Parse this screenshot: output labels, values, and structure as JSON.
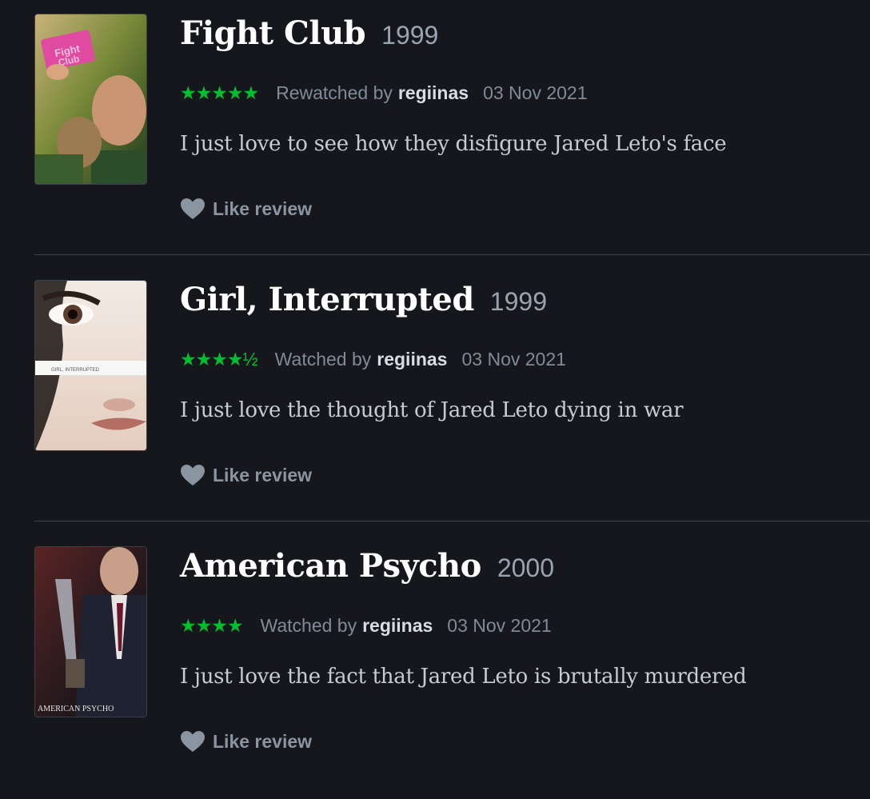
{
  "colors": {
    "background": "#15171c",
    "star_green": "#00c030",
    "muted_text": "#7f8b97",
    "divider": "#3b414b"
  },
  "reviews": [
    {
      "title": "Fight Club",
      "year": "1999",
      "stars": "★★★★★",
      "rating": 5,
      "activity": "Rewatched by",
      "username": "regiinas",
      "date": "03 Nov 2021",
      "text": "I just love to see how they disfigure Jared Leto's face",
      "like_label": "Like review",
      "like_icon": "heart-icon"
    },
    {
      "title": "Girl, Interrupted",
      "year": "1999",
      "stars": "★★★★½",
      "rating": 4.5,
      "activity": "Watched by",
      "username": "regiinas",
      "date": "03 Nov 2021",
      "text": "I just love the thought of Jared Leto dying in war",
      "like_label": "Like review",
      "like_icon": "heart-icon"
    },
    {
      "title": "American Psycho",
      "year": "2000",
      "stars": "★★★★",
      "rating": 4,
      "activity": "Watched by",
      "username": "regiinas",
      "date": "03 Nov 2021",
      "text": "I just love the fact that Jared Leto is brutally murdered",
      "like_label": "Like review",
      "like_icon": "heart-icon"
    }
  ]
}
